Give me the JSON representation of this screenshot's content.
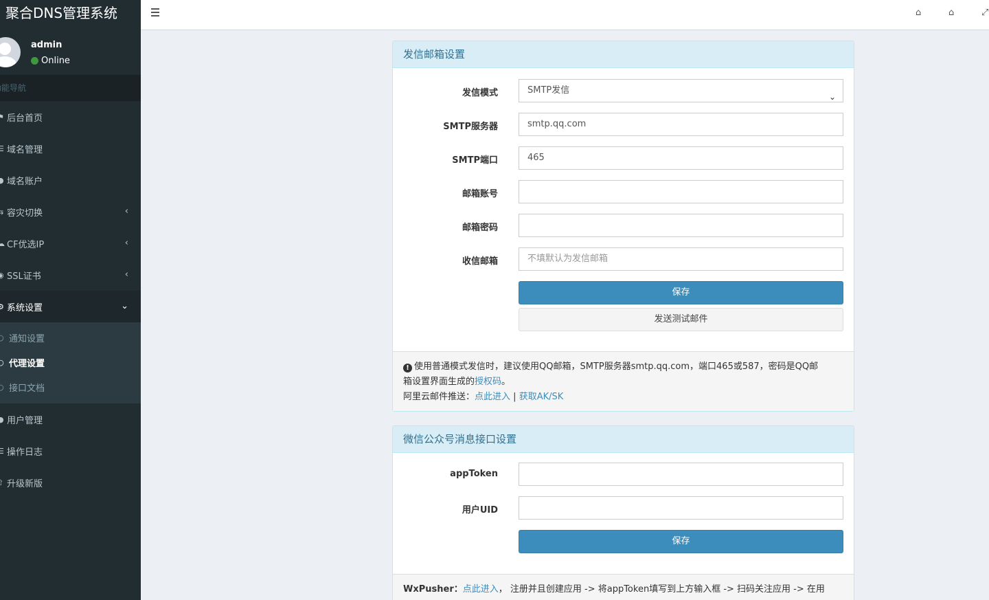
{
  "app": {
    "title": "聚合DNS管理系统"
  },
  "user": {
    "name": "admin",
    "status": "Online"
  },
  "sidebar": {
    "header": "功能导航",
    "items": [
      {
        "label": "后台首页",
        "icon": "home-icon"
      },
      {
        "label": "域名管理",
        "icon": "list-icon"
      },
      {
        "label": "域名账户",
        "icon": "user-icon"
      },
      {
        "label": "容灾切换",
        "icon": "switch-icon"
      },
      {
        "label": "CF优选IP",
        "icon": "cloud-icon"
      },
      {
        "label": "SSL证书",
        "icon": "certificate-icon"
      },
      {
        "label": "系统设置",
        "icon": "cogs-icon"
      },
      {
        "label": "用户管理",
        "icon": "user-icon"
      },
      {
        "label": "操作日志",
        "icon": "list-icon"
      },
      {
        "label": "升级新版",
        "icon": "upload-icon"
      }
    ],
    "sub_items": [
      {
        "label": "通知设置"
      },
      {
        "label": "代理设置"
      },
      {
        "label": "接口文档"
      }
    ]
  },
  "mail_panel": {
    "title": "发信邮箱设置",
    "mode_label": "发信模式",
    "mode_value": "SMTP发信",
    "server_label": "SMTP服务器",
    "server_value": "smtp.qq.com",
    "port_label": "SMTP端口",
    "port_value": "465",
    "account_label": "邮箱账号",
    "account_value": "",
    "password_label": "邮箱密码",
    "password_value": "",
    "receiver_label": "收信邮箱",
    "receiver_placeholder": "不填默认为发信邮箱",
    "save_label": "保存",
    "test_label": "发送测试邮件",
    "footer": {
      "tip_line1": "使用普通模式发信时，建议使用QQ邮箱，SMTP服务器smtp.qq.com，端口465或587，密码是QQ邮",
      "tip_line2_prefix": "箱设置界面生成的",
      "auth_code_link": "授权码",
      "tip_line2_suffix": "。",
      "aliyun_prefix": "阿里云邮件推送：",
      "aliyun_link": "点此进入",
      "separator": " | ",
      "aksk_link": "获取AK/SK"
    }
  },
  "wechat_panel": {
    "title": "微信公众号消息接口设置",
    "token_label": "appToken",
    "token_value": "",
    "uid_label": "用户UID",
    "uid_value": "",
    "save_label": "保存",
    "footer": {
      "prefix": "WxPusher：",
      "link": "点此进入",
      "text": "， 注册并且创建应用 -> 将appToken填写到上方输入框 -> 扫码关注应用 -> 在用"
    }
  }
}
